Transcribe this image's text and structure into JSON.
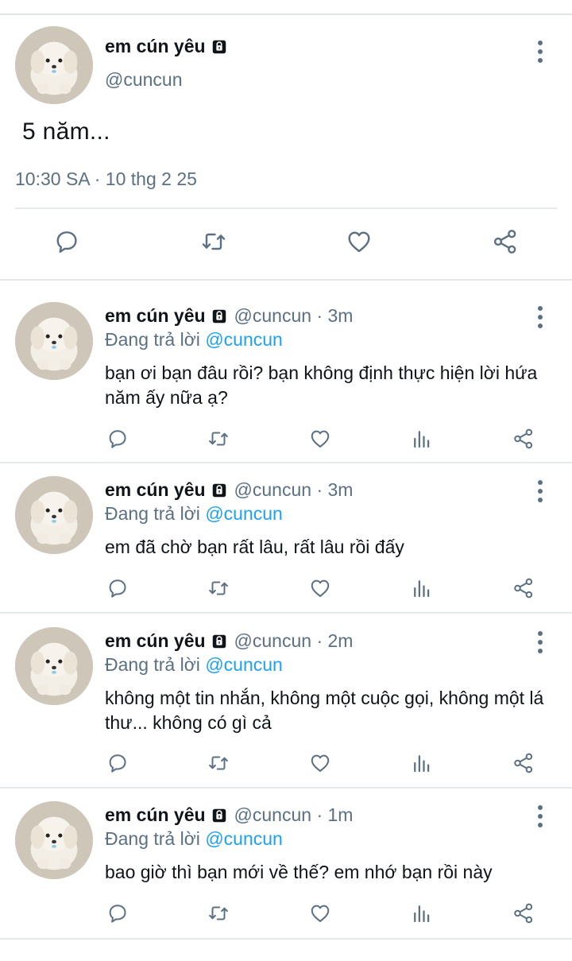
{
  "main_tweet": {
    "display_name": "em cún yêu",
    "handle": "@cuncun",
    "text": "5  năm...",
    "meta": "10:30 SA · 10 thg 2 25",
    "avatar_icon": "puppy-avatar",
    "protected_icon": "lock-icon"
  },
  "replies": [
    {
      "display_name": "em cún yêu",
      "handle_time": "@cuncun · 3m",
      "replying_prefix": "Đang trả lời ",
      "replying_to": "@cuncun",
      "text": "bạn ơi bạn đâu rồi? bạn không định thực hiện lời hứa năm ấy nữa ạ?"
    },
    {
      "display_name": "em cún yêu",
      "handle_time": "@cuncun · 3m",
      "replying_prefix": "Đang trả lời ",
      "replying_to": "@cuncun",
      "text": "em đã chờ bạn rất lâu, rất lâu rồi đấy"
    },
    {
      "display_name": "em cún yêu",
      "handle_time": "@cuncun · 2m",
      "replying_prefix": "Đang trả lời ",
      "replying_to": "@cuncun",
      "text": "không một tin nhắn, không một cuộc gọi, không một lá thư... không có gì cả"
    },
    {
      "display_name": "em cún yêu",
      "handle_time": "@cuncun · 1m",
      "replying_prefix": "Đang trả lời ",
      "replying_to": "@cuncun",
      "text": "bao giờ thì bạn mới về thế? em nhớ bạn rồi này"
    }
  ],
  "colors": {
    "text": "#0f1419",
    "secondary": "#5b7083",
    "mention": "#1da1f2",
    "divider": "#e6e9eb"
  }
}
